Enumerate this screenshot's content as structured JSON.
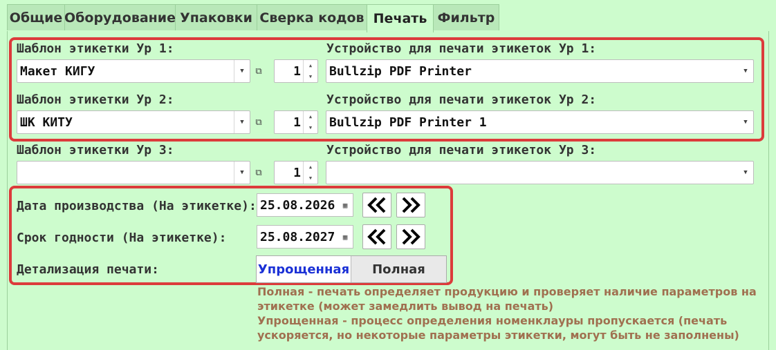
{
  "tabs": [
    {
      "label": "Общие"
    },
    {
      "label": "Оборудование"
    },
    {
      "label": "Упаковки"
    },
    {
      "label": "Сверка кодов"
    },
    {
      "label": "Печать"
    },
    {
      "label": "Фильтр"
    }
  ],
  "levels": [
    {
      "template_label": "Шаблон этикетки Ур 1:",
      "template_value": "Макет КИГУ",
      "copies": "1",
      "device_label": "Устройство для печати этикеток Ур 1:",
      "device_value": "Bullzip PDF Printer"
    },
    {
      "template_label": "Шаблон этикетки Ур 2:",
      "template_value": "ШК КИТУ",
      "copies": "1",
      "device_label": "Устройство для печати этикеток Ур 2:",
      "device_value": "Bullzip PDF Printer 1"
    },
    {
      "template_label": "Шаблон этикетки Ур 3:",
      "template_value": "",
      "copies": "1",
      "device_label": "Устройство для печати этикеток Ур 3:",
      "device_value": ""
    }
  ],
  "production_date": {
    "label": "Дата производства (На этикетке):",
    "value": "25.08.2026"
  },
  "expiry_date": {
    "label": "Срок годности (На этикетке):",
    "value": "25.08.2027"
  },
  "detail": {
    "label": "Детализация печати:",
    "options": [
      "Упрощенная",
      "Полная"
    ],
    "selected": "Упрощенная"
  },
  "notes": [
    "Полная -  печать определяет продукцию и проверяет наличие параметров на",
    "этикетке (может замедлить вывод на печать)",
    "Упрощенная - процесс определения номенклауры пропускается (печать",
    "ускоряется, но некоторые параметры этикетки, могут быть не заполнены)"
  ],
  "colors": {
    "background": "#cdfccd",
    "highlight": "#dc3b3b",
    "selected_option": "#1a30d6",
    "note": "#a07050"
  }
}
